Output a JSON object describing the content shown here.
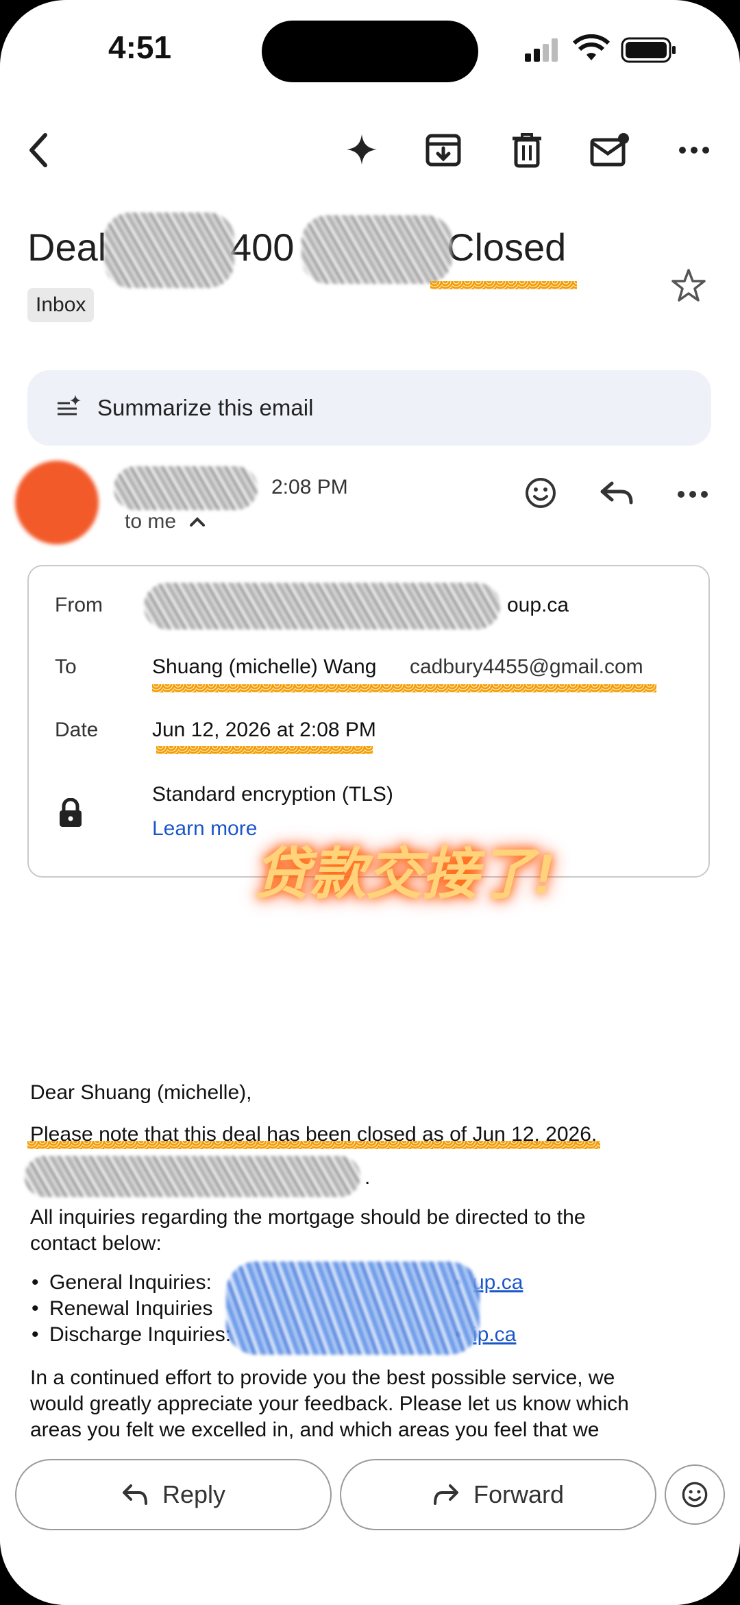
{
  "status": {
    "time": "4:51"
  },
  "toolbar": {
    "back": "back-icon",
    "icons": [
      "sparkle-icon",
      "archive-icon",
      "trash-icon",
      "mark-unread-icon",
      "more-icon"
    ]
  },
  "subject": {
    "start": "Deal",
    "middle": "400",
    "end": "Closed"
  },
  "label": "Inbox",
  "summarize": {
    "label": "Summarize this email"
  },
  "sender": {
    "time": "2:08 PM",
    "to_me": "to me"
  },
  "details": {
    "from_label": "From",
    "from_value": "oup.ca",
    "to_label": "To",
    "to_name": "Shuang (michelle) Wang",
    "to_email": "cadbury4455@gmail.com",
    "date_label": "Date",
    "date_value": "Jun 12, 2026 at 2:08 PM",
    "encryption": "Standard encryption (TLS)",
    "learn_more": "Learn more"
  },
  "overlay_text": "贷款交接了!",
  "email": {
    "greeting": "Dear Shuang (michelle),",
    "line1": "Please note that this deal has been closed as of Jun 12, 2026.",
    "line2": "All inquiries regarding the mortgage should be directed to the",
    "line3": "contact below:",
    "bullets": [
      {
        "label": "General Inquiries:",
        "link": "up.ca"
      },
      {
        "label": "Renewal Inquiries",
        "link": ""
      },
      {
        "label": "Discharge Inquiries:",
        "link": "ip.ca"
      }
    ],
    "para1": "In a continued effort to provide you the best possible service, we",
    "para2": "would greatly appreciate your feedback. Please let us know which",
    "para3": "areas you felt we excelled in, and which areas you feel that we"
  },
  "actions": {
    "reply": "Reply",
    "forward": "Forward"
  },
  "colors": {
    "accent": "#1a56c8",
    "highlight": "#f59c00",
    "avatar": "#f25a2a"
  }
}
